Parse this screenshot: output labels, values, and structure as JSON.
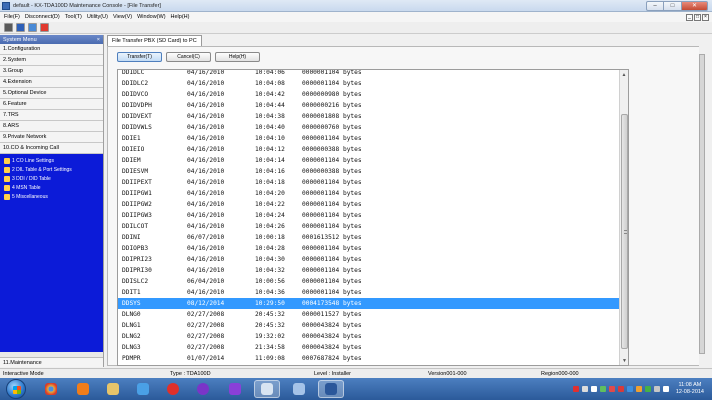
{
  "window": {
    "title": "default - KX-TDA100D Maintenance Console - [File Transfer]",
    "controls": {
      "minimize": "–",
      "maximize": "□",
      "close": "✕"
    }
  },
  "menubar": {
    "items": [
      "File(F)",
      "Disconnect(D)",
      "Tool(T)",
      "Utility(U)",
      "View(V)",
      "Window(W)",
      "Help(H)"
    ],
    "mdi_controls": [
      "_",
      "□",
      "×"
    ]
  },
  "toolbar": {
    "icons": [
      "disconnect-icon",
      "save-icon",
      "program-icon",
      "help-icon"
    ]
  },
  "sidebar": {
    "header": "System Menu",
    "header_close": "×",
    "items": [
      "1.Configuration",
      "2.System",
      "3.Group",
      "4.Extension",
      "5.Optional Device",
      "6.Feature",
      "7.TRS",
      "8.ARS",
      "9.Private Network",
      "10.CO & Incoming Call"
    ],
    "subitems": [
      "1 CO Line Settings",
      "2 DIL Table & Port Settings",
      "3 DDI / DID Table",
      "4 MSN Table",
      "5 Miscellaneous"
    ],
    "bottom_item": "11.Maintenance"
  },
  "main": {
    "tab": "File Transfer PBX (SD Card) to PC",
    "buttons": {
      "transfer": "Transfer(T)",
      "cancel": "Cancel(C)",
      "help": "Help(H)"
    },
    "scroll": {
      "up": "▲",
      "down": "▼"
    },
    "selected_index": 21,
    "files": [
      {
        "name": "DDIDLC",
        "date": "04/16/2010",
        "time": "10:04:06",
        "size": "0000001104 bytes"
      },
      {
        "name": "DDIDLC2",
        "date": "04/16/2010",
        "time": "10:04:08",
        "size": "0000001104 bytes"
      },
      {
        "name": "DDIDVCO",
        "date": "04/16/2010",
        "time": "10:04:42",
        "size": "0000000980 bytes"
      },
      {
        "name": "DDIDVDPH",
        "date": "04/16/2010",
        "time": "10:04:44",
        "size": "0000000216 bytes"
      },
      {
        "name": "DDIDVEXT",
        "date": "04/16/2010",
        "time": "10:04:38",
        "size": "0000001808 bytes"
      },
      {
        "name": "DDIDVWLS",
        "date": "04/16/2010",
        "time": "10:04:40",
        "size": "0000000760 bytes"
      },
      {
        "name": "DDIE1",
        "date": "04/16/2010",
        "time": "10:04:10",
        "size": "0000001104 bytes"
      },
      {
        "name": "DDIEIO",
        "date": "04/16/2010",
        "time": "10:04:12",
        "size": "0000000388 bytes"
      },
      {
        "name": "DDIEM",
        "date": "04/16/2010",
        "time": "10:04:14",
        "size": "0000001104 bytes"
      },
      {
        "name": "DDIESVM",
        "date": "04/16/2010",
        "time": "10:04:16",
        "size": "0000000388 bytes"
      },
      {
        "name": "DDIIPEXT",
        "date": "04/16/2010",
        "time": "10:04:18",
        "size": "0000001104 bytes"
      },
      {
        "name": "DDIIPGW1",
        "date": "04/16/2010",
        "time": "10:04:20",
        "size": "0000001104 bytes"
      },
      {
        "name": "DDIIPGW2",
        "date": "04/16/2010",
        "time": "10:04:22",
        "size": "0000001104 bytes"
      },
      {
        "name": "DDIIPGW3",
        "date": "04/16/2010",
        "time": "10:04:24",
        "size": "0000001104 bytes"
      },
      {
        "name": "DDILCOT",
        "date": "04/16/2010",
        "time": "10:04:26",
        "size": "0000001104 bytes"
      },
      {
        "name": "DDINI",
        "date": "06/07/2010",
        "time": "10:00:18",
        "size": "0001613512 bytes"
      },
      {
        "name": "DDIOPB3",
        "date": "04/16/2010",
        "time": "10:04:28",
        "size": "0000001104 bytes"
      },
      {
        "name": "DDIPRI23",
        "date": "04/16/2010",
        "time": "10:04:30",
        "size": "0000001104 bytes"
      },
      {
        "name": "DDIPRI30",
        "date": "04/16/2010",
        "time": "10:04:32",
        "size": "0000001104 bytes"
      },
      {
        "name": "DDISLC2",
        "date": "06/04/2010",
        "time": "10:00:56",
        "size": "0000001104 bytes"
      },
      {
        "name": "DDIT1",
        "date": "04/16/2010",
        "time": "10:04:36",
        "size": "0000001104 bytes"
      },
      {
        "name": "DDSYS",
        "date": "08/12/2014",
        "time": "10:29:50",
        "size": "0004173548 bytes"
      },
      {
        "name": "DLNG0",
        "date": "02/27/2008",
        "time": "20:45:32",
        "size": "0000011527 bytes"
      },
      {
        "name": "DLNG1",
        "date": "02/27/2008",
        "time": "20:45:32",
        "size": "0000043824 bytes"
      },
      {
        "name": "DLNG2",
        "date": "02/27/2008",
        "time": "19:32:02",
        "size": "0000043824 bytes"
      },
      {
        "name": "DLNG3",
        "date": "02/27/2008",
        "time": "21:34:58",
        "size": "0000043824 bytes"
      },
      {
        "name": "PDMPR",
        "date": "01/07/2014",
        "time": "11:09:08",
        "size": "0007687824 bytes"
      }
    ]
  },
  "status": {
    "mode": "Interactive Mode",
    "type": "Type : TDA100D",
    "level": "Level : Installer",
    "version": "Version001-000",
    "region": "Region000-000"
  },
  "taskbar": {
    "time": "11:08 AM",
    "date": "12-08-2014"
  }
}
